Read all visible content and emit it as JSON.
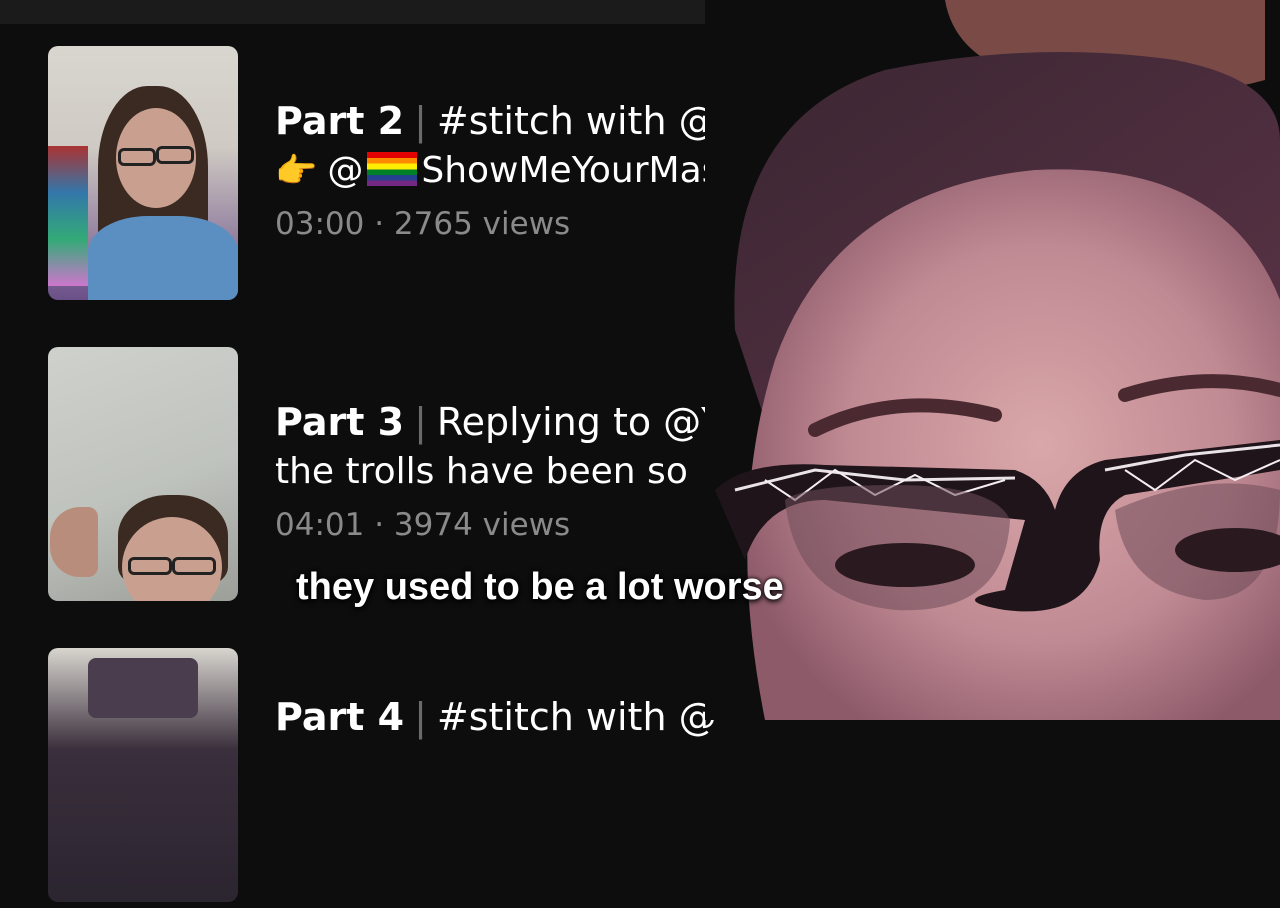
{
  "videos": [
    {
      "part": "Part 2",
      "title": "#stitch with @NAtv•Art",
      "line2_user": "ShowMeYourMask",
      "duration": "03:00",
      "views": "2765 views"
    },
    {
      "part": "Part 3",
      "title": "Replying to @Y",
      "line2": "the trolls have been so",
      "duration": "04:01",
      "views": "3974 views"
    },
    {
      "part": "Part 4",
      "title": "#stitch with @"
    }
  ],
  "caption": "they used to be a lot worse",
  "symbols": {
    "at": "@",
    "pointing_hand": "👉",
    "separator": "|",
    "dot": "·"
  }
}
